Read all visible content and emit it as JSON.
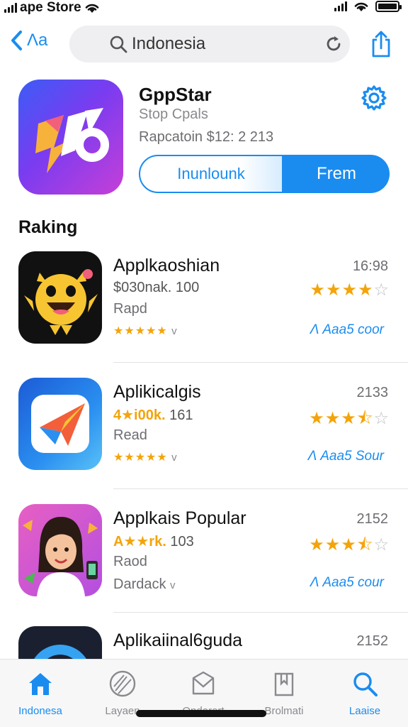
{
  "status_bar": {
    "carrier": "ape Store"
  },
  "nav": {
    "back_label": "Λa",
    "search_value": "Indonesia"
  },
  "featured": {
    "title": "GppStar",
    "subtitle": "Stop Cpals",
    "meta": "Rapcatoin $12: 2 213",
    "button_outline": "Inunlounk",
    "button_fill": "Frem"
  },
  "section_title": "Raking",
  "apps": [
    {
      "name": "Applkaoshian",
      "line2_hl": "",
      "line2": "$030nak. 100",
      "line3": "Rapd",
      "line4_stars": "★★★★★",
      "line4_suffix": "v",
      "line4_text": "",
      "number": "16:98",
      "rating": 4,
      "link": "Λ Aaa5 coor"
    },
    {
      "name": "Aplikicalgis",
      "line2_hl": "4★i00k.",
      "line2": " 161",
      "line3": "Read",
      "line4_stars": "★★★★★",
      "line4_suffix": "v",
      "line4_text": "",
      "number": "2133",
      "rating": 3.5,
      "link": "Λ Aaa5 Sour"
    },
    {
      "name": "Applkais Popular",
      "line2_hl": "A★★rk.",
      "line2": " 103",
      "line3": "Raod",
      "line4_stars": "",
      "line4_suffix": "v",
      "line4_text": "Dardack",
      "number": "2152",
      "rating": 3.5,
      "link": "Λ Aaa5 cour"
    },
    {
      "name": "Aplikaiinal6guda",
      "line2_hl": "",
      "line2": "",
      "line3": "",
      "line4_stars": "",
      "line4_suffix": "",
      "line4_text": "",
      "number": "2152",
      "rating": 0,
      "link": ""
    }
  ],
  "tabs": [
    {
      "label": "Indonesa",
      "icon": "home-icon",
      "active": true
    },
    {
      "label": "Layaen",
      "icon": "compass-icon",
      "active": false
    },
    {
      "label": "Ondarort",
      "icon": "envelope-icon",
      "active": false
    },
    {
      "label": "Brolmati",
      "icon": "bookmark-icon",
      "active": false
    },
    {
      "label": "Laaise",
      "icon": "search-icon",
      "active": true
    }
  ],
  "colors": {
    "accent": "#1a8cf0",
    "star": "#f3a40b",
    "star_off": "#bfbfc4"
  }
}
